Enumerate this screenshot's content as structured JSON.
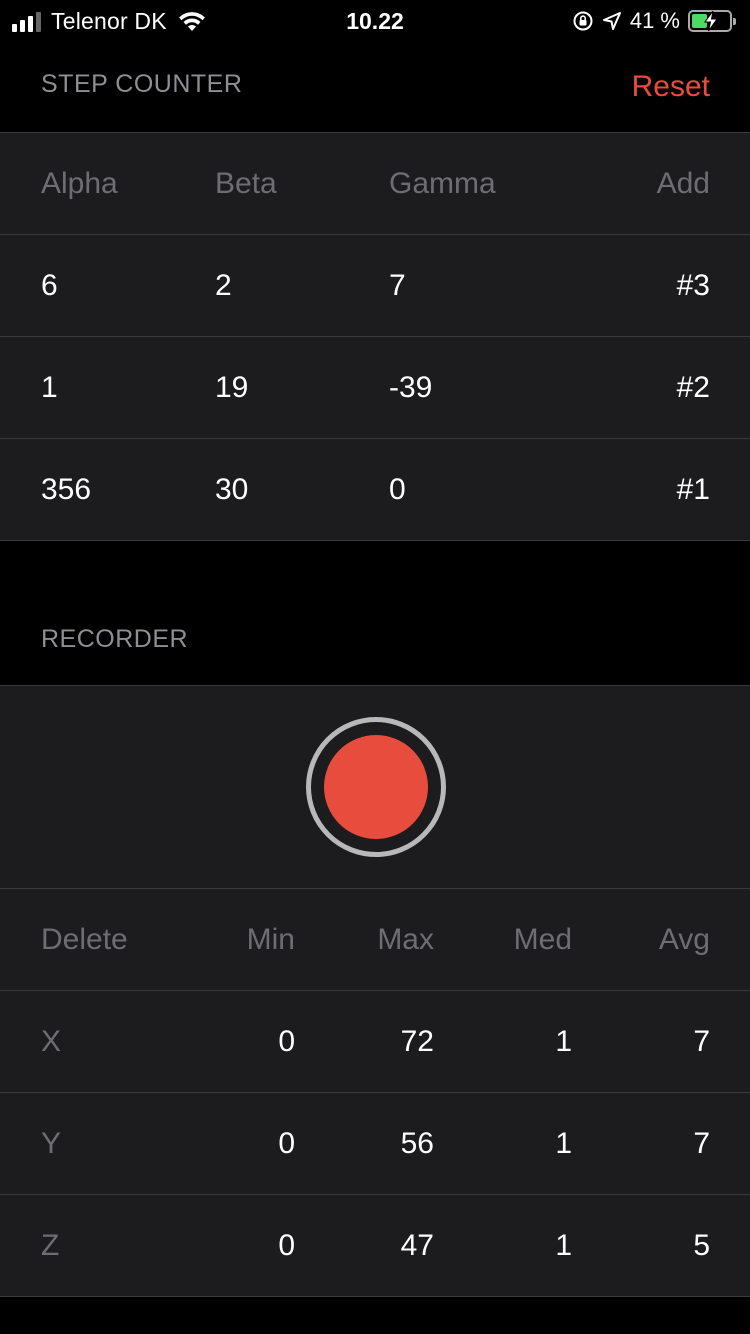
{
  "status_bar": {
    "carrier": "Telenor DK",
    "time": "10.22",
    "battery_text": "41 %",
    "battery_level": 0.41
  },
  "step_counter": {
    "title": "STEP COUNTER",
    "reset_label": "Reset",
    "columns": [
      "Alpha",
      "Beta",
      "Gamma"
    ],
    "add_label": "Add",
    "rows": [
      {
        "alpha": "6",
        "beta": "2",
        "gamma": "7",
        "id": "#3"
      },
      {
        "alpha": "1",
        "beta": "19",
        "gamma": "-39",
        "id": "#2"
      },
      {
        "alpha": "356",
        "beta": "30",
        "gamma": "0",
        "id": "#1"
      }
    ]
  },
  "recorder": {
    "title": "RECORDER",
    "delete_label": "Delete",
    "columns": [
      "Min",
      "Max",
      "Med",
      "Avg"
    ],
    "rows": [
      {
        "axis": "X",
        "min": "0",
        "max": "72",
        "med": "1",
        "avg": "7"
      },
      {
        "axis": "Y",
        "min": "0",
        "max": "56",
        "med": "1",
        "avg": "7"
      },
      {
        "axis": "Z",
        "min": "0",
        "max": "47",
        "med": "1",
        "avg": "5"
      }
    ]
  },
  "colors": {
    "accent_red": "#e84c3d",
    "accent_blue": "#3b82f6",
    "background": "#000000",
    "cell_background": "#1c1c1e"
  }
}
